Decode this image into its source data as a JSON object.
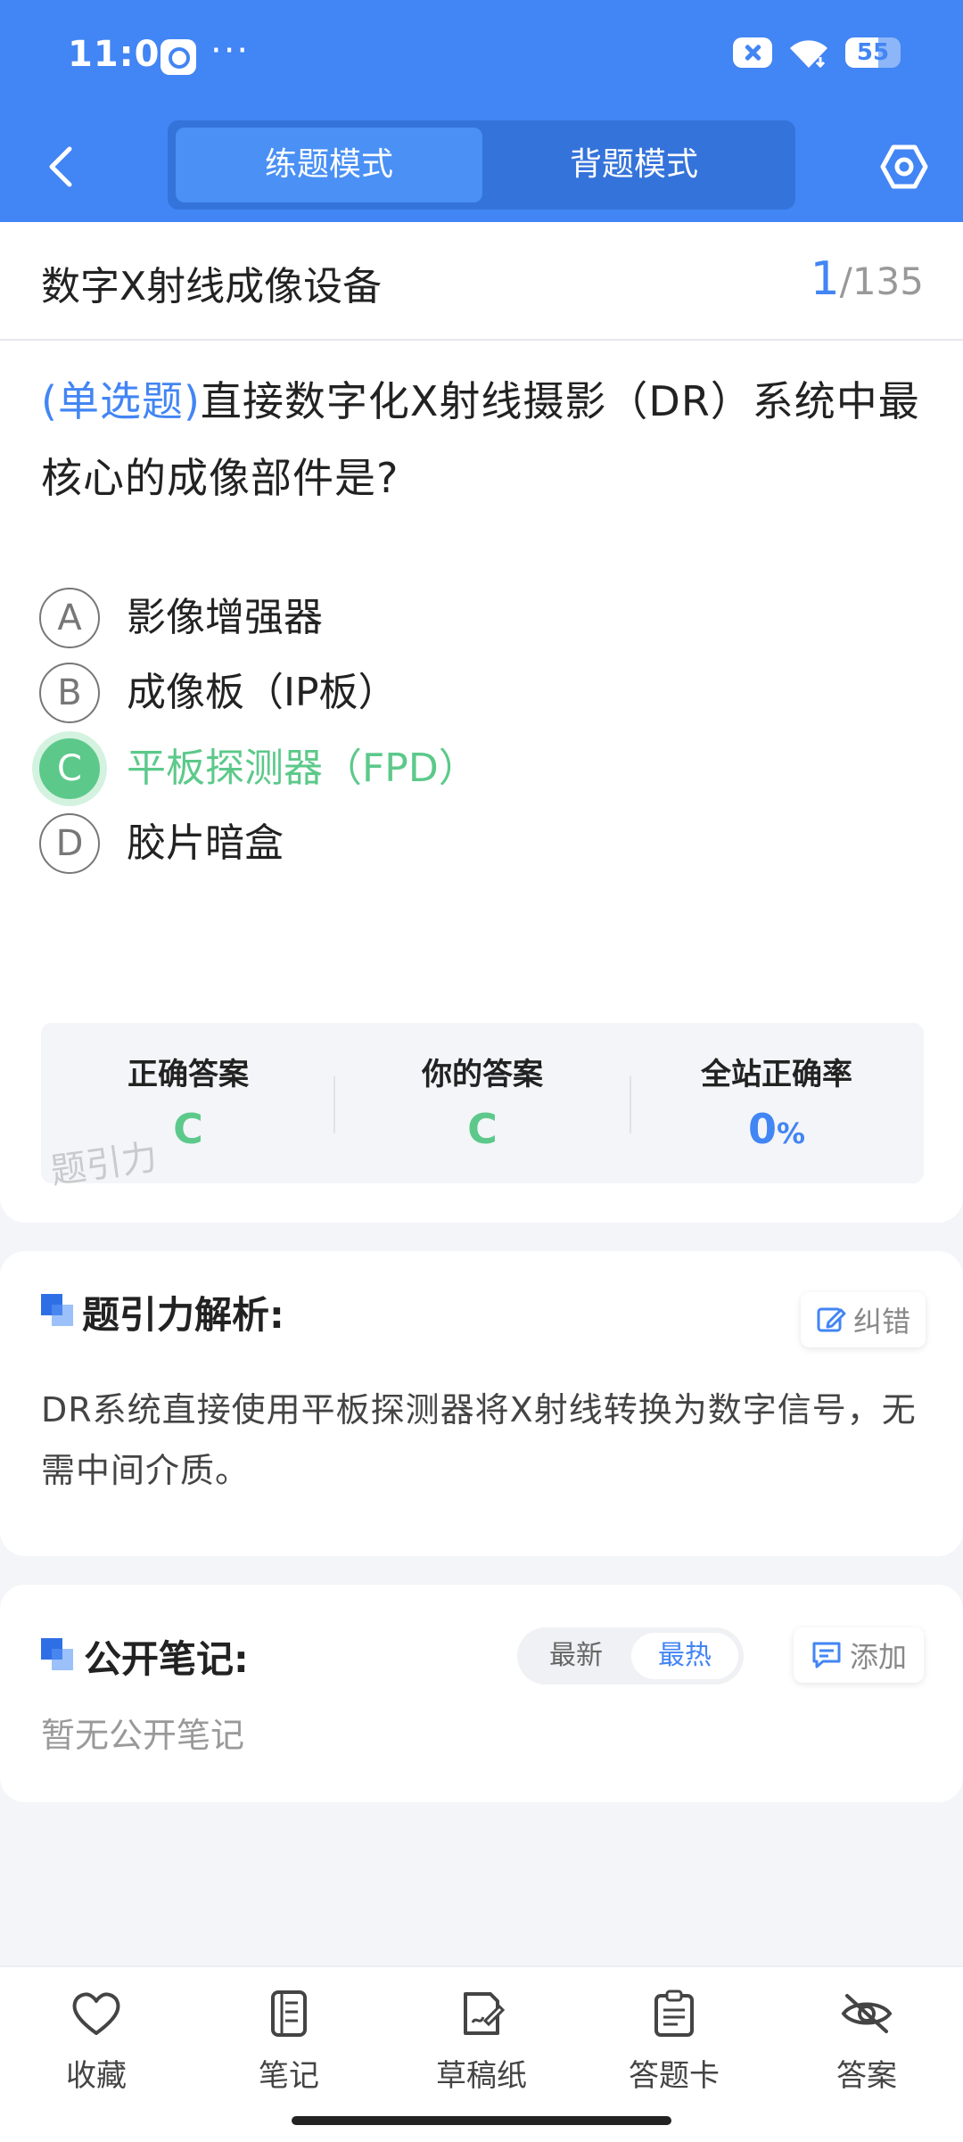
{
  "status_bar": {
    "time": "11:01",
    "dots": "···",
    "battery": "55"
  },
  "nav": {
    "tab_practice": "练题模式",
    "tab_recite": "背题模式"
  },
  "question": {
    "section_title": "数字X射线成像设备",
    "current": "1",
    "total": "/135",
    "type_label": "(单选题)",
    "text": "直接数字化X射线摄影（DR）系统中最核心的成像部件是?",
    "options": [
      {
        "letter": "A",
        "text": "影像增强器"
      },
      {
        "letter": "B",
        "text": "成像板（IP板）"
      },
      {
        "letter": "C",
        "text": "平板探测器（FPD）"
      },
      {
        "letter": "D",
        "text": "胶片暗盒"
      }
    ],
    "selected": "C"
  },
  "answer_box": {
    "correct_label": "正确答案",
    "correct_value": "C",
    "yours_label": "你的答案",
    "yours_value": "C",
    "rate_label": "全站正确率",
    "rate_value": "0",
    "rate_unit": "%",
    "watermark": "题引力"
  },
  "analysis": {
    "heading": "题引力解析:",
    "report_label": "纠错",
    "text": "DR系统直接使用平板探测器将X射线转换为数字信号，无需中间介质。"
  },
  "notes": {
    "heading": "公开笔记:",
    "sort_latest": "最新",
    "sort_hottest": "最热",
    "add_label": "添加",
    "empty": "暂无公开笔记"
  },
  "bottom_bar": {
    "items": [
      {
        "label": "收藏",
        "icon": "heart-icon"
      },
      {
        "label": "笔记",
        "icon": "notebook-icon"
      },
      {
        "label": "草稿纸",
        "icon": "draft-icon"
      },
      {
        "label": "答题卡",
        "icon": "clipboard-icon"
      },
      {
        "label": "答案",
        "icon": "eye-off-icon"
      }
    ]
  },
  "colors": {
    "primary": "#4285f4",
    "correct": "#5cc98a"
  }
}
